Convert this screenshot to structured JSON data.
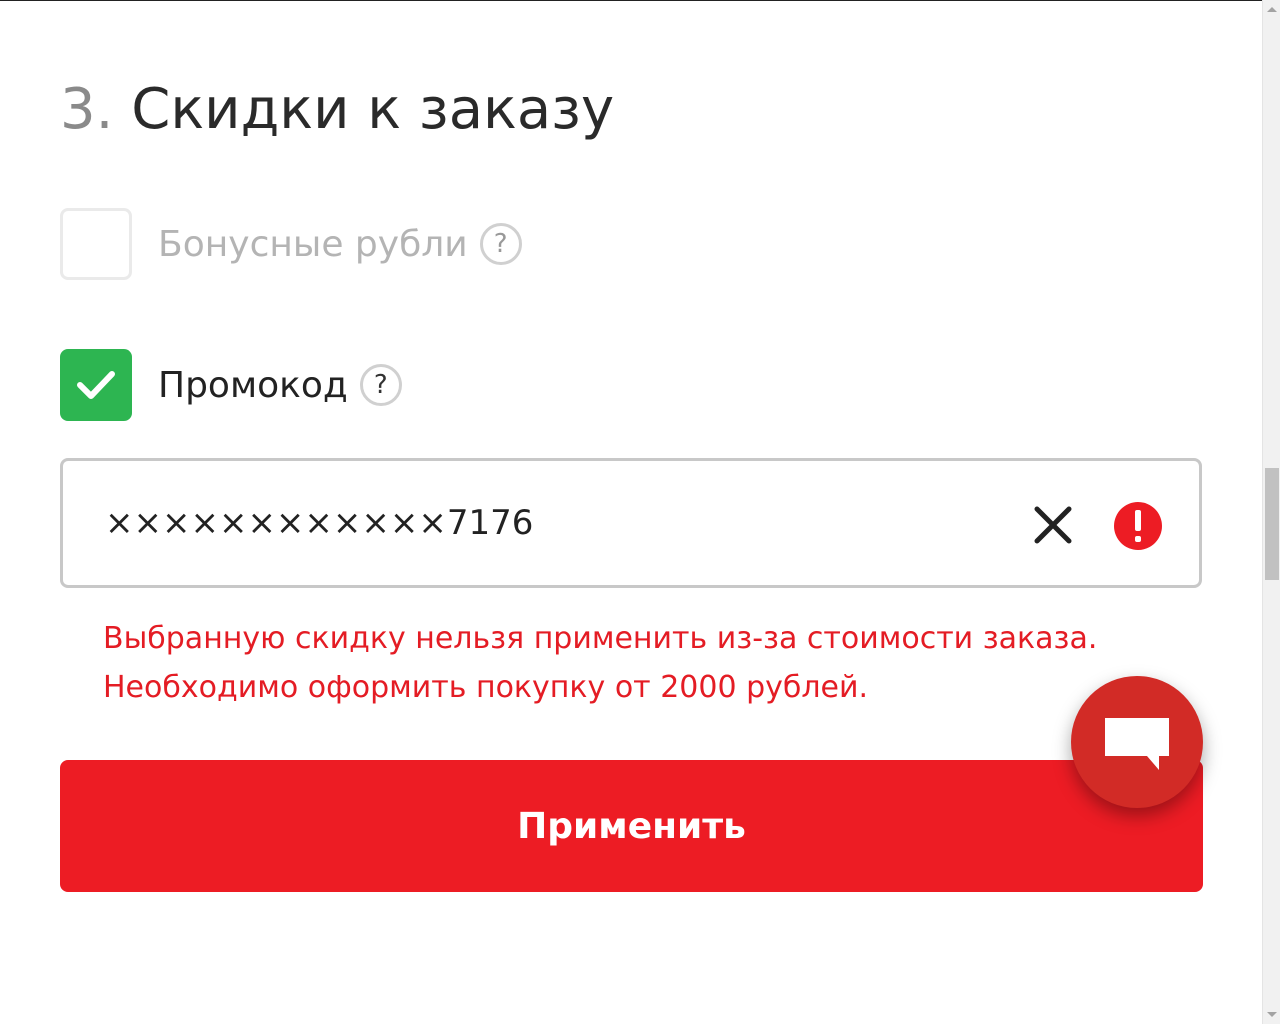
{
  "section": {
    "number": "3.",
    "title": "Скидки к заказу"
  },
  "bonus_option": {
    "label": "Бонусные рубли",
    "checked": false,
    "help_symbol": "?"
  },
  "promo_option": {
    "label": "Промокод",
    "checked": true,
    "help_symbol": "?"
  },
  "promo_input": {
    "value": "××××××××××××7176"
  },
  "error": {
    "line1": "Выбранную скидку нельзя применить из-за стоимости заказа.",
    "line2": "Необходимо оформить покупку от 2000 рублей."
  },
  "apply_button": {
    "label": "Применить"
  },
  "icons": {
    "checkmark": "checkmark-icon",
    "clear": "close-icon",
    "error": "exclamation-icon",
    "chat": "chat-bubble-icon"
  },
  "colors": {
    "accent_red": "#ed1c24",
    "error_text": "#e41c24",
    "check_green": "#2db551",
    "chat_button": "#d22b26"
  }
}
